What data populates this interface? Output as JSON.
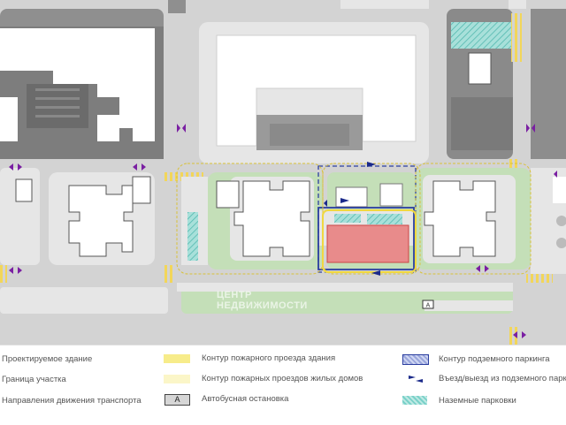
{
  "map": {
    "watermark": [
      "ЦЕНТР",
      "НЕДВИЖИМОСТИ"
    ],
    "bus_stop_marker": "А",
    "colors": {
      "road": "#d3d3d3",
      "lawn": "#c4dfb8",
      "courtyard": "#e6e6e6",
      "building": "#ffffff",
      "roof_gray": "#9e9e9e",
      "proposed_building": "#e88b8b",
      "fire_lane": "#f5ec88",
      "crosswalk": "#f4cf3d",
      "underground_parking": "#2c3fa0",
      "ground_parking": "#7ad1c9",
      "traffic_arrow": "#7a1fa2"
    }
  },
  "legend": {
    "items": [
      {
        "label": "Проектируемое здание",
        "icon": "proposed-building-swatch"
      },
      {
        "label": "Граница участка",
        "icon": "site-boundary-line"
      },
      {
        "label": "Направления движения транспорта",
        "icon": "traffic-direction-arrows"
      },
      {
        "label": "Контур пожарного проезда здания",
        "icon": "fire-lane-building-swatch"
      },
      {
        "label": "Контур пожарных проездов жилых домов",
        "icon": "fire-lane-residential-swatch"
      },
      {
        "label": "Автобусная остановка",
        "icon": "bus-stop-box"
      },
      {
        "label": "Контур подземного паркинга",
        "icon": "underground-parking-swatch"
      },
      {
        "label": "Въезд/выезд из подземного паркинга",
        "icon": "parking-entry-arrows"
      },
      {
        "label": "Наземные парковки",
        "icon": "ground-parking-swatch"
      }
    ],
    "bus_stop_letter": "А"
  }
}
